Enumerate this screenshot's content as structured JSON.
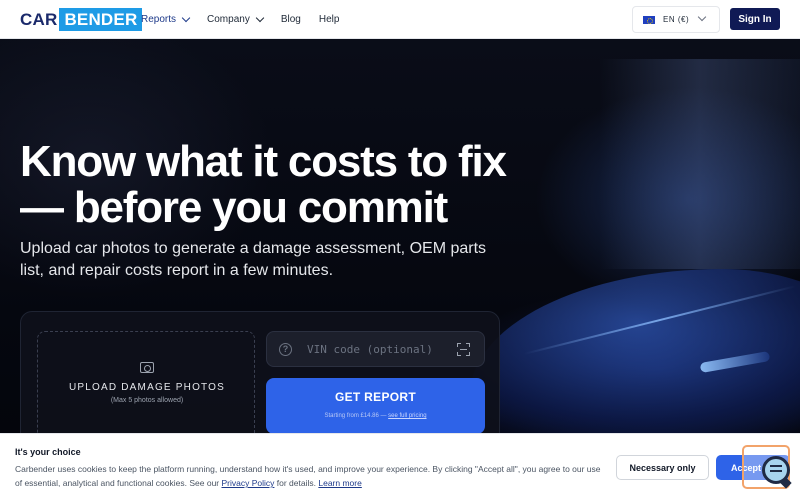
{
  "header": {
    "logo_left": "CAR",
    "logo_right": "BENDER",
    "nav": [
      {
        "label": "Reports",
        "dropdown": true
      },
      {
        "label": "Company",
        "dropdown": true
      },
      {
        "label": "Blog",
        "dropdown": false
      },
      {
        "label": "Help",
        "dropdown": false
      }
    ],
    "language": "EN (€)",
    "signin_label": "Sign In"
  },
  "hero": {
    "title": "Know what it costs to fix — before you commit",
    "subtitle": "Upload car photos to generate a damage assessment, OEM parts list, and repair costs report in a few minutes.",
    "upload": {
      "title": "UPLOAD DAMAGE PHOTOS",
      "note": "(Max 5 photos allowed)"
    },
    "vin_placeholder": "VIN code (optional)",
    "get_report_label": "GET REPORT",
    "price_text": "Starting from £14.86 —",
    "pricing_link": "see full pricing"
  },
  "cookie": {
    "title": "It's your choice",
    "text": "Carbender uses cookies to keep the platform running, understand how it's used, and improve your experience. By clicking \"Accept all\", you agree to our use of essential, analytical and functional cookies. See our",
    "privacy_link": "Privacy Policy",
    "text_tail": "for details.",
    "learn_more": "Learn more",
    "necessary_label": "Necessary only",
    "accept_label": "Accept"
  },
  "colors": {
    "brand_navy": "#101a55",
    "brand_blue": "#1e9be6",
    "accent": "#2e63e8",
    "hero_bg": "#05070f"
  },
  "icons": [
    "flag-eu-icon",
    "chevron-down-icon",
    "camera-plus-icon",
    "question-circle-icon",
    "scan-icon",
    "chat-icon"
  ]
}
